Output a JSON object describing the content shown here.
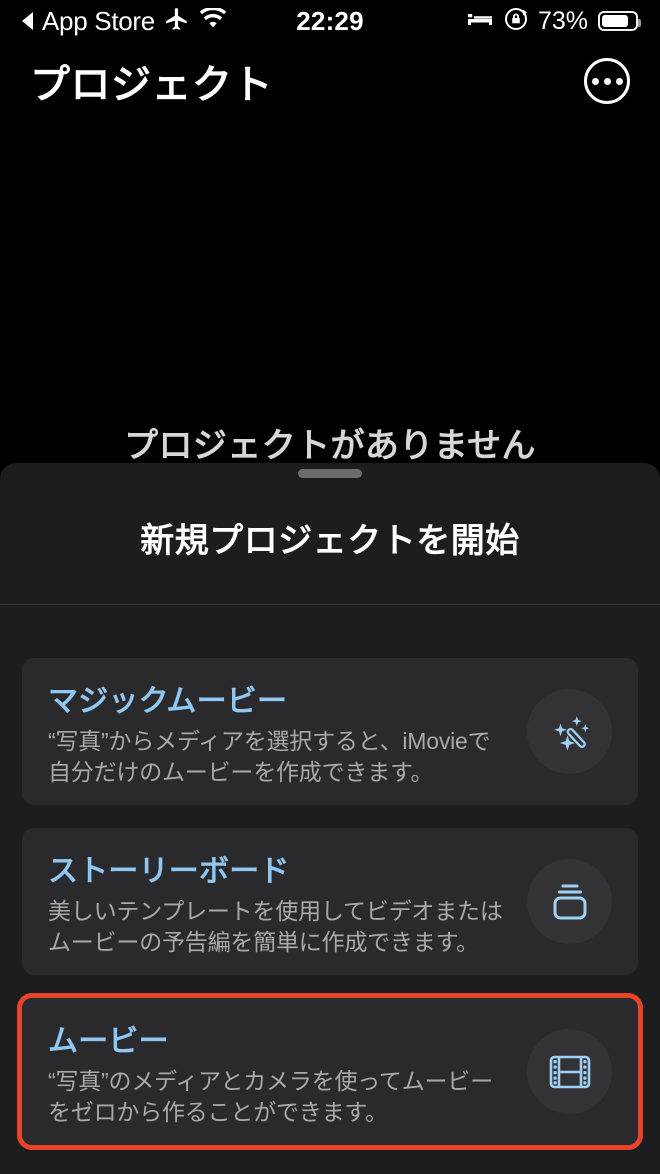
{
  "statusbar": {
    "back_arrow_icon": "back-triangle-icon",
    "carrier": "App Store",
    "airplane_icon": "airplane-mode-icon",
    "wifi_icon": "wifi-icon",
    "time": "22:29",
    "bed_icon": "sleep-focus-icon",
    "rotation_lock_icon": "rotation-lock-icon",
    "battery_percent": "73%",
    "battery_icon": "battery-icon"
  },
  "navbar": {
    "title": "プロジェクト",
    "more_icon": "more-ellipsis-icon"
  },
  "empty_state": {
    "message": "プロジェクトがありません"
  },
  "sheet": {
    "grabber": "sheet-grabber-handle",
    "title": "新規プロジェクトを開始",
    "options": [
      {
        "title": "マジックムービー",
        "desc_line1": "“写真”からメディアを選択すると、iMovieで",
        "desc_line2": "自分だけのムービーを作成できます。",
        "icon": "magic-wand-sparkles-icon",
        "highlighted": false
      },
      {
        "title": "ストーリーボード",
        "desc_line1": "美しいテンプレートを使用してビデオまたは",
        "desc_line2": "ムービーの予告編を簡単に作成できます。",
        "icon": "storyboard-stack-icon",
        "highlighted": false
      },
      {
        "title": "ムービー",
        "desc_line1": "“写真”のメディアとカメラを使ってムービー",
        "desc_line2": "をゼロから作ることができます。",
        "icon": "film-strip-icon",
        "highlighted": true
      }
    ]
  },
  "colors": {
    "background": "#000000",
    "sheet_background": "#1d1d1f",
    "card_background": "#2a2a2c",
    "accent_blue": "#8fc7f2",
    "highlight_red": "#e8442a",
    "secondary_text": "#a9a9ad"
  }
}
